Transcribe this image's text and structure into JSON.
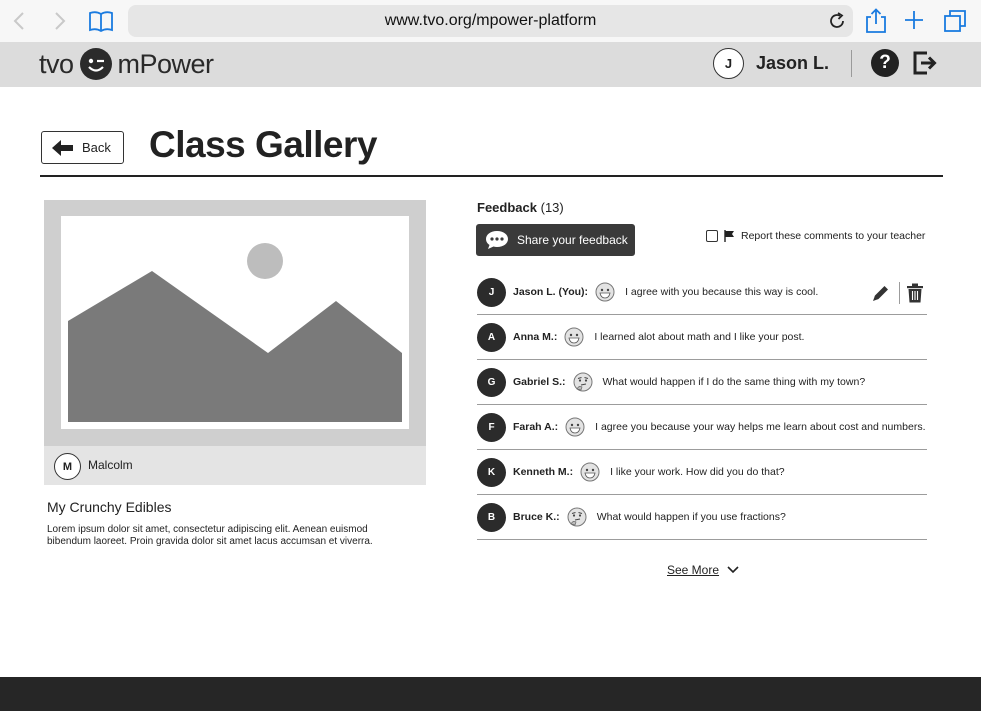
{
  "browser": {
    "url": "www.tvo.org/mpower-platform",
    "icons": [
      "back-icon",
      "forward-icon",
      "bookmarks-icon",
      "reload-icon",
      "share-icon",
      "new-tab-icon",
      "tabs-icon"
    ]
  },
  "header": {
    "logo_left": "tvo",
    "logo_right": "mPower",
    "user_initial": "J",
    "user_name": "Jason L.",
    "help_label": "?"
  },
  "page": {
    "back_label": "Back",
    "title": "Class Gallery"
  },
  "post": {
    "author_initial": "M",
    "author_name": "Malcolm",
    "title": "My Crunchy Edibles",
    "description": "Lorem ipsum dolor sit amet, consectetur adipiscing elit. Aenean euismod bibendum laoreet. Proin gravida dolor sit amet lacus accumsan et viverra."
  },
  "feedback": {
    "heading": "Feedback",
    "count": "(13)",
    "share_label": "Share your feedback",
    "report_label": "Report these comments to your teacher",
    "see_more": "See More",
    "comments": [
      {
        "initial": "J",
        "name": "Jason L. (You):",
        "emoji": "grin",
        "text": "I agree with you because this way is cool."
      },
      {
        "initial": "A",
        "name": "Anna M.:",
        "emoji": "grin",
        "text": "I learned alot about math and I like your post."
      },
      {
        "initial": "G",
        "name": "Gabriel S.:",
        "emoji": "thinking",
        "text": "What would happen if I do the same thing with my town?"
      },
      {
        "initial": "F",
        "name": "Farah A.:",
        "emoji": "grin",
        "text": "I agree you because your way helps me learn about cost and numbers."
      },
      {
        "initial": "K",
        "name": "Kenneth M.:",
        "emoji": "grin",
        "text": "I like your work. How did you do that?"
      },
      {
        "initial": "B",
        "name": "Bruce K.:",
        "emoji": "thinking",
        "text": "What would happen if you use fractions?"
      }
    ]
  }
}
